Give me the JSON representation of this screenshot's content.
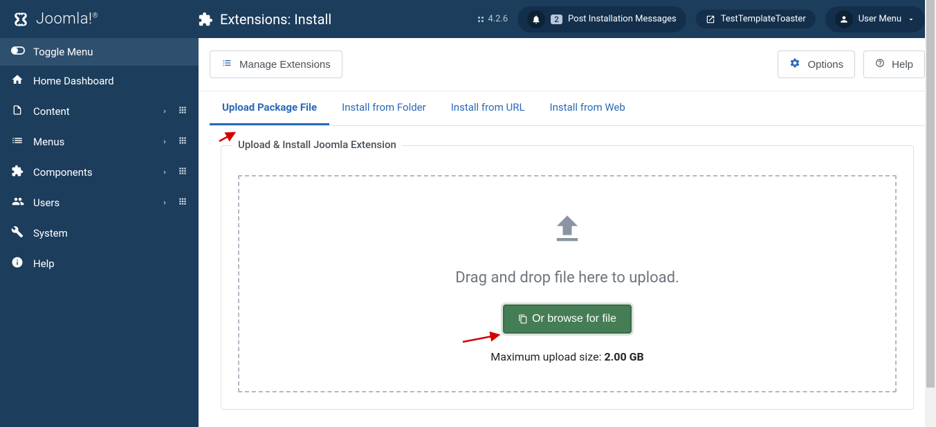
{
  "header": {
    "brand": "Joomla!",
    "page_title": "Extensions: Install",
    "version": "4.2.6",
    "notifications_count": "2",
    "notifications_label": "Post Installation Messages",
    "template_label": "TestTemplateToaster",
    "usermenu_label": "User Menu"
  },
  "sidebar": {
    "toggle": "Toggle Menu",
    "items": [
      {
        "label": "Home Dashboard",
        "icon": "home",
        "expandable": false,
        "dash": false
      },
      {
        "label": "Content",
        "icon": "file",
        "expandable": true,
        "dash": true
      },
      {
        "label": "Menus",
        "icon": "list",
        "expandable": true,
        "dash": true
      },
      {
        "label": "Components",
        "icon": "puzzle",
        "expandable": true,
        "dash": true
      },
      {
        "label": "Users",
        "icon": "users",
        "expandable": true,
        "dash": true
      },
      {
        "label": "System",
        "icon": "wrench",
        "expandable": false,
        "dash": false
      },
      {
        "label": "Help",
        "icon": "info",
        "expandable": false,
        "dash": false
      }
    ]
  },
  "toolbar": {
    "manage_label": "Manage Extensions",
    "options_label": "Options",
    "help_label": "Help"
  },
  "tabs": [
    {
      "label": "Upload Package File",
      "active": true
    },
    {
      "label": "Install from Folder",
      "active": false
    },
    {
      "label": "Install from URL",
      "active": false
    },
    {
      "label": "Install from Web",
      "active": false
    }
  ],
  "upload": {
    "legend": "Upload & Install Joomla Extension",
    "drop_text": "Drag and drop file here to upload.",
    "browse_label": "Or browse for file",
    "max_prefix": "Maximum upload size: ",
    "max_value": "2.00 GB"
  }
}
